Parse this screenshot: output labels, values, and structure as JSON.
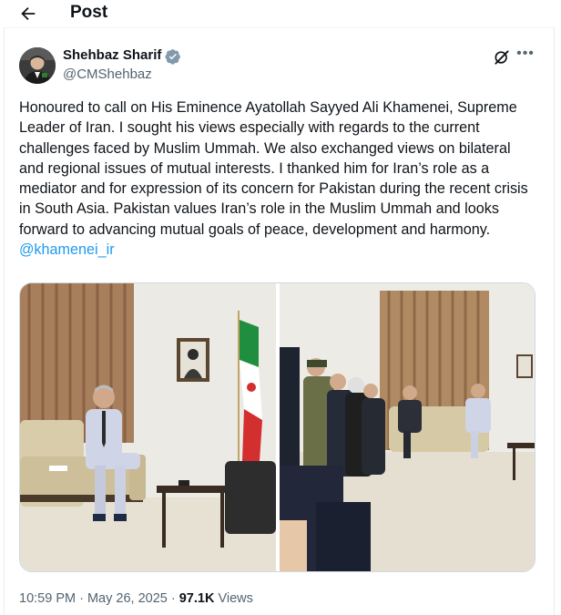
{
  "header": {
    "title": "Post"
  },
  "author": {
    "name": "Shehbaz Sharif",
    "handle": "@CMShehbaz"
  },
  "tweet": {
    "text": "Honoured to call on His Eminence Ayatollah Sayyed Ali Khamenei, Supreme Leader of Iran. I sought his views especially with regards to the current challenges faced by Muslim Ummah. We also exchanged views on bilateral and regional issues of mutual interests. I thanked him for Iran’s role as a mediator and for expression of its concern for Pakistan during the recent crisis in South Asia. Pakistan values Iran’s role in the Muslim Ummah and looks forward to advancing mutual goals of peace, development and harmony.",
    "mention": "@khamenei_ir"
  },
  "meta": {
    "time": "10:59 PM",
    "sep1": " · ",
    "date": "May 26, 2025",
    "sep2": " · ",
    "views_count": "97.1K",
    "views_label": " Views"
  },
  "icons": {
    "back": "back-arrow-icon",
    "verified": "verified-badge-icon",
    "grok": "grok-icon",
    "more": "more-options-icon"
  },
  "colors": {
    "link": "#1d9bf0",
    "verified": "#829aab",
    "secondary_text": "#536471"
  }
}
